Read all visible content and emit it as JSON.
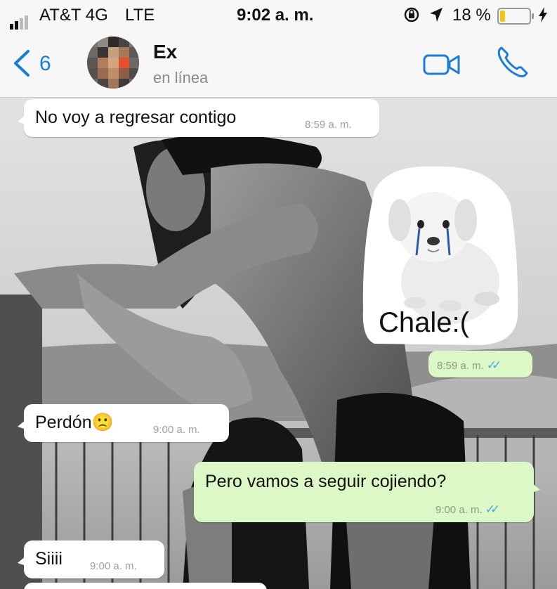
{
  "status_bar": {
    "carrier": "AT&T 4G",
    "network": "LTE",
    "time": "9:02 a. m.",
    "battery": "18 %",
    "battery_level": 0.18,
    "battery_color": "#f3c614",
    "icons": [
      "signal-bars-icon",
      "orientation-lock-icon",
      "location-arrow-icon",
      "battery-icon",
      "charging-bolt-icon"
    ]
  },
  "header": {
    "back_count": "6",
    "contact_name": "Ex",
    "contact_status": "en línea",
    "accent_color": "#1a7ddb",
    "icons": [
      "back-chevron-icon",
      "video-call-icon",
      "phone-call-icon"
    ]
  },
  "messages": [
    {
      "direction": "incoming",
      "text": "No voy a regresar contigo",
      "time": "8:59 a. m."
    },
    {
      "direction": "outgoing",
      "type": "sticker",
      "sticker": "crying-puppy",
      "text": "Chale:(",
      "time": "8:59 a. m.",
      "read": true
    },
    {
      "direction": "incoming",
      "text": "Perdón",
      "emoji": "🙁",
      "time": "9:00 a. m."
    },
    {
      "direction": "outgoing",
      "text": "Pero vamos a seguir cojiendo?",
      "time": "9:00 a. m.",
      "read": true
    },
    {
      "direction": "incoming",
      "text": "Siiii",
      "time": "9:00 a. m."
    }
  ],
  "colors": {
    "incoming_bubble": "#ffffff",
    "outgoing_bubble": "#dcf8c6",
    "read_ticks": "#4aa9e8"
  }
}
